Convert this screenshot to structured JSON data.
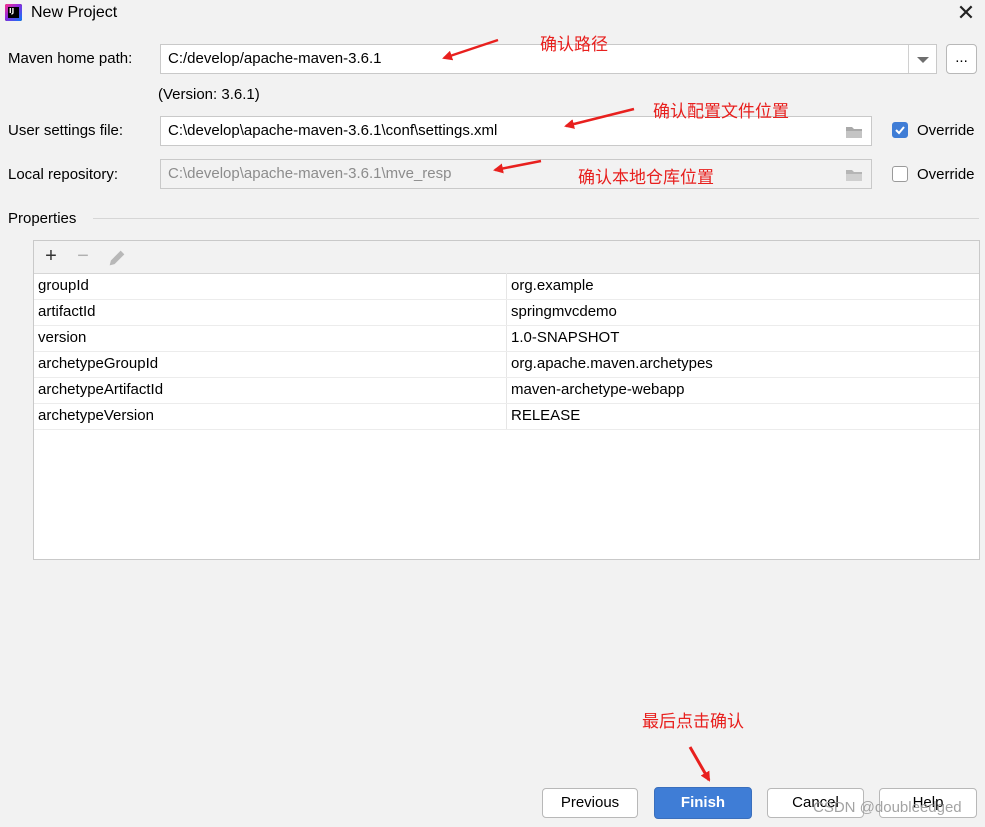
{
  "window": {
    "title": "New Project",
    "close_glyph": "✕"
  },
  "maven_home": {
    "label": "Maven home path:",
    "value": "C:/develop/apache-maven-3.6.1",
    "version": "(Version: 3.6.1)",
    "browse_label": "..."
  },
  "user_settings": {
    "label": "User settings file:",
    "value": "C:\\develop\\apache-maven-3.6.1\\conf\\settings.xml",
    "override_label": "Override",
    "override_checked": true
  },
  "local_repo": {
    "label": "Local repository:",
    "value": "C:\\develop\\apache-maven-3.6.1\\mve_resp",
    "override_label": "Override",
    "override_checked": false
  },
  "properties": {
    "section_label": "Properties",
    "rows": [
      {
        "key": "groupId",
        "value": "org.example"
      },
      {
        "key": "artifactId",
        "value": "springmvcdemo"
      },
      {
        "key": "version",
        "value": "1.0-SNAPSHOT"
      },
      {
        "key": "archetypeGroupId",
        "value": "org.apache.maven.archetypes"
      },
      {
        "key": "archetypeArtifactId",
        "value": "maven-archetype-webapp"
      },
      {
        "key": "archetypeVersion",
        "value": "RELEASE"
      }
    ]
  },
  "annotations": {
    "confirm_path": "确认路径",
    "confirm_settings": "确认配置文件位置",
    "confirm_local_repo": "确认本地仓库位置",
    "finish_confirm": "最后点击确认"
  },
  "buttons": {
    "previous": "Previous",
    "finish": "Finish",
    "cancel": "Cancel",
    "help": "Help"
  },
  "watermark": "CSDN @doubleedged",
  "colors": {
    "accent": "#3f7dd6",
    "annotation": "#e8201e"
  }
}
